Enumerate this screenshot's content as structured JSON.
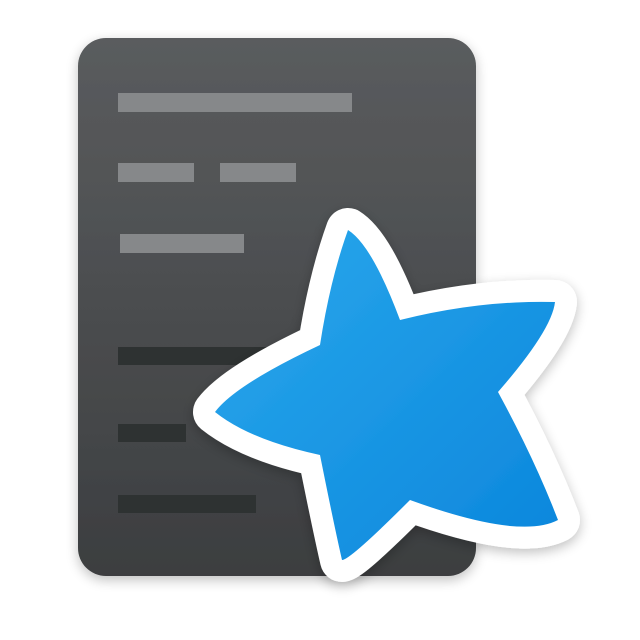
{
  "icon": {
    "name": "app-icon",
    "parts": [
      "card-document-icon",
      "star-icon"
    ]
  },
  "colors": {
    "background": "#ffffff",
    "card_top": "#5a5c5e",
    "card_bottom": "#3c3e40",
    "card_line_light": "#86888a",
    "card_line_dark": "#2e3032",
    "star_top": "#2aa8ec",
    "star_bottom": "#0b86dc",
    "star_outline": "#ffffff"
  }
}
